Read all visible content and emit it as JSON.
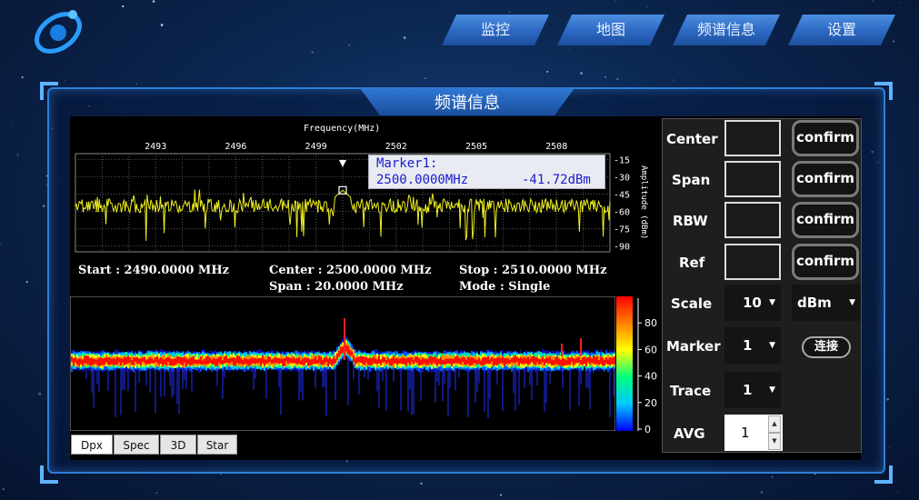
{
  "nav": {
    "items": [
      {
        "label": "监控"
      },
      {
        "label": "地图"
      },
      {
        "label": "频谱信息"
      },
      {
        "label": "设置"
      }
    ]
  },
  "panel": {
    "title": "频谱信息"
  },
  "marker": {
    "title": "Marker1:",
    "freq": "2500.0000MHz",
    "level": "-41.72dBm"
  },
  "info": {
    "start": "Start : 2490.0000 MHz",
    "center": "Center : 2500.0000 MHz",
    "stop": "Stop : 2510.0000 MHz",
    "span": "Span : 20.0000 MHz",
    "mode": "Mode : Single"
  },
  "tabs": [
    {
      "label": "Dpx"
    },
    {
      "label": "Spec"
    },
    {
      "label": "3D"
    },
    {
      "label": "Star"
    }
  ],
  "controls": {
    "center_label": "Center",
    "span_label": "Span",
    "rbw_label": "RBW",
    "ref_label": "Ref",
    "confirm_label": "confirm",
    "scale_label": "Scale",
    "scale_value": "10",
    "unit_value": "dBm",
    "marker_label": "Marker",
    "marker_value": "1",
    "trace_label": "Trace",
    "trace_value": "1",
    "avg_label": "AVG",
    "avg_value": "1",
    "connect_label": "连接"
  },
  "chart_data": [
    {
      "type": "line",
      "xlabel": "Frequency(MHz)",
      "ylabel": "Amplitude (dBm)",
      "xlim": [
        2490,
        2510
      ],
      "ylim": [
        -95,
        -10
      ],
      "x_ticks": [
        2493,
        2496,
        2499,
        2502,
        2505,
        2508
      ],
      "y_ticks": [
        -15,
        -30,
        -45,
        -60,
        -75,
        -90
      ],
      "series": [
        {
          "color": "#f0f020",
          "noise_floor_dbm": -55,
          "peak": {
            "x": 2500.0,
            "y": -41.72
          }
        }
      ],
      "marker": {
        "x": 2500.0,
        "y": -41.72
      }
    },
    {
      "type": "heatmap",
      "colorbar_ticks": [
        0,
        20,
        40,
        60,
        80
      ],
      "colormap": [
        "#0000ff",
        "#00c8ff",
        "#00ff80",
        "#ffff00",
        "#ff8000",
        "#ff0000"
      ]
    }
  ]
}
